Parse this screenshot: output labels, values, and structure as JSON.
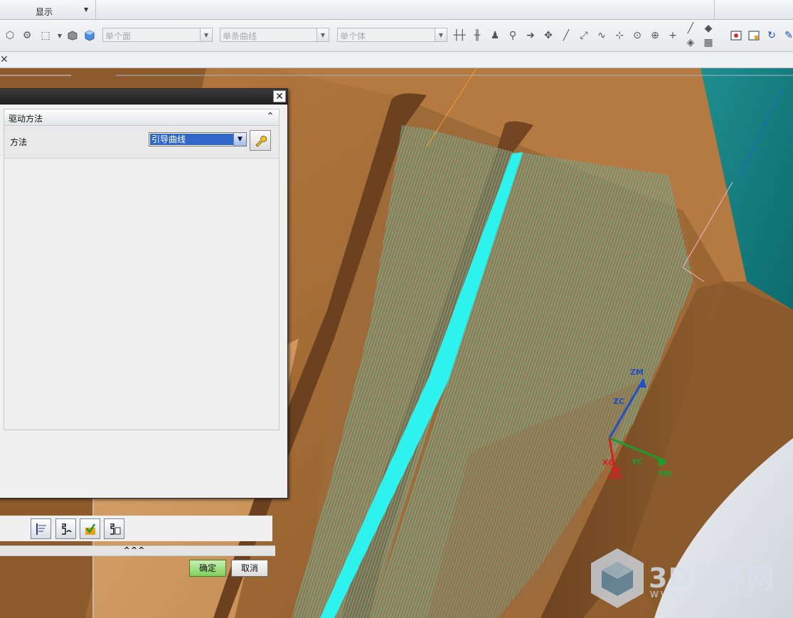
{
  "ribbon": {
    "display_label": "显示"
  },
  "toolbar": {
    "face_filter": "单个面",
    "curve_filter": "单条曲线",
    "body_filter": "单个体"
  },
  "tabs": {
    "close_symbol": "✕"
  },
  "dialog": {
    "section_title": "驱动方法",
    "method_label": "方法",
    "method_value": "引导曲线",
    "expander_label": "^^^",
    "ok_label": "确定",
    "cancel_label": "取消"
  },
  "axes": {
    "zm": "ZM",
    "zc": "ZC",
    "xc": "XC",
    "xm": "XM",
    "yc": "YC",
    "ym": "YM"
  },
  "watermark": {
    "brand": "3D世界网",
    "url": "WWW.3DSJW.COM"
  },
  "colors": {
    "material": "#a46b37",
    "toolpath": "#21e0dc",
    "dialog_title": "#2a2a2a",
    "method_highlight": "#3167c6"
  }
}
